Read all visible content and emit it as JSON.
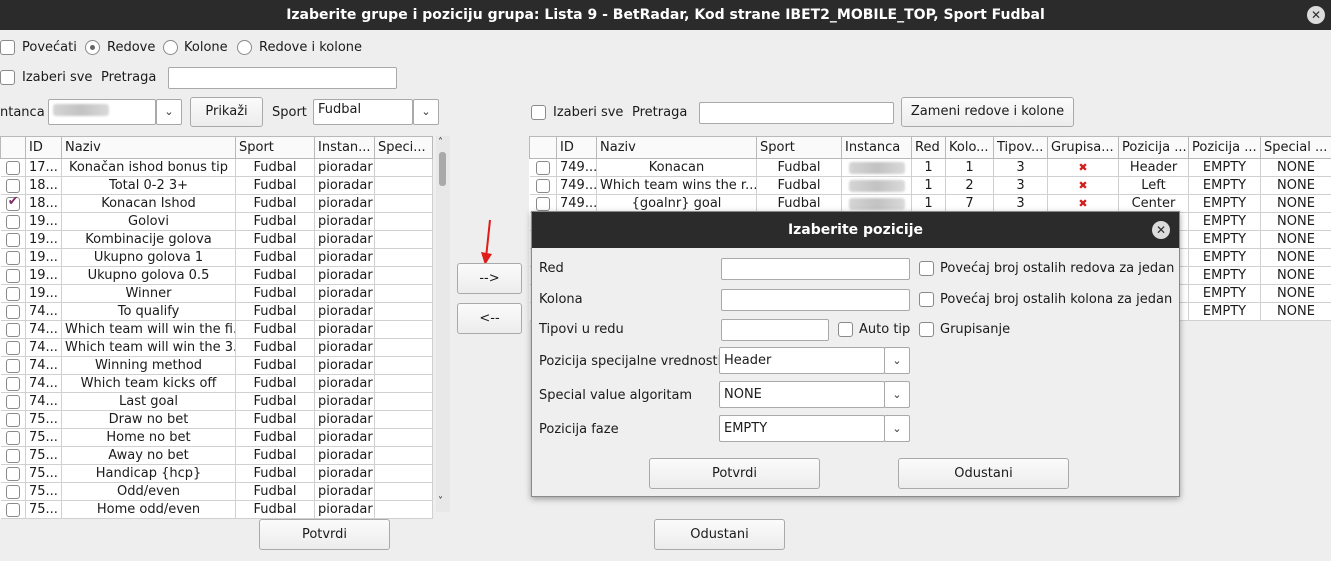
{
  "window": {
    "title": "Izaberite grupe i poziciju grupa: Lista 9 - BetRadar, Kod strane IBET2_MOBILE_TOP, Sport Fudbal",
    "close": "✕"
  },
  "top_options": {
    "povecati": "Povećati",
    "redove": "Redove",
    "kolone": "Kolone",
    "redove_i_kolone": "Redove i kolone"
  },
  "left": {
    "select_all": "Izaberi sve",
    "search_label": "Pretraga",
    "search_value": "",
    "instance_label": "ntanca",
    "show_button": "Prikaži",
    "sport_label": "Sport",
    "sport_value": "Fudbal",
    "columns": [
      "",
      "ID",
      "Naziv",
      "Sport",
      "Instan...",
      "Speci..."
    ],
    "rows": [
      {
        "checked": false,
        "id": "17...",
        "naziv": "Konačan ishod bonus tip",
        "sport": "Fudbal",
        "instanca": "pioradar"
      },
      {
        "checked": false,
        "id": "18...",
        "naziv": "Total 0-2 3+",
        "sport": "Fudbal",
        "instanca": "pioradar"
      },
      {
        "checked": true,
        "id": "18...",
        "naziv": "Konacan Ishod",
        "sport": "Fudbal",
        "instanca": "pioradar"
      },
      {
        "checked": false,
        "id": "19...",
        "naziv": "Golovi",
        "sport": "Fudbal",
        "instanca": "pioradar"
      },
      {
        "checked": false,
        "id": "19...",
        "naziv": "Kombinacije golova",
        "sport": "Fudbal",
        "instanca": "pioradar"
      },
      {
        "checked": false,
        "id": "19...",
        "naziv": "Ukupno golova 1",
        "sport": "Fudbal",
        "instanca": "pioradar"
      },
      {
        "checked": false,
        "id": "19...",
        "naziv": "Ukupno golova 0.5",
        "sport": "Fudbal",
        "instanca": "pioradar"
      },
      {
        "checked": false,
        "id": "19...",
        "naziv": "Winner",
        "sport": "Fudbal",
        "instanca": "pioradar"
      },
      {
        "checked": false,
        "id": "74...",
        "naziv": "To qualify",
        "sport": "Fudbal",
        "instanca": "pioradar"
      },
      {
        "checked": false,
        "id": "74...",
        "naziv": "Which team will win the fi...",
        "sport": "Fudbal",
        "instanca": "pioradar"
      },
      {
        "checked": false,
        "id": "74...",
        "naziv": "Which team will win the 3...",
        "sport": "Fudbal",
        "instanca": "pioradar"
      },
      {
        "checked": false,
        "id": "74...",
        "naziv": "Winning method",
        "sport": "Fudbal",
        "instanca": "pioradar"
      },
      {
        "checked": false,
        "id": "74...",
        "naziv": "Which team kicks off",
        "sport": "Fudbal",
        "instanca": "pioradar"
      },
      {
        "checked": false,
        "id": "74...",
        "naziv": "Last goal",
        "sport": "Fudbal",
        "instanca": "pioradar"
      },
      {
        "checked": false,
        "id": "75...",
        "naziv": "Draw no bet",
        "sport": "Fudbal",
        "instanca": "pioradar"
      },
      {
        "checked": false,
        "id": "75...",
        "naziv": "Home no bet",
        "sport": "Fudbal",
        "instanca": "pioradar"
      },
      {
        "checked": false,
        "id": "75...",
        "naziv": "Away no bet",
        "sport": "Fudbal",
        "instanca": "pioradar"
      },
      {
        "checked": false,
        "id": "75...",
        "naziv": "Handicap {hcp}",
        "sport": "Fudbal",
        "instanca": "pioradar"
      },
      {
        "checked": false,
        "id": "75...",
        "naziv": "Odd/even",
        "sport": "Fudbal",
        "instanca": "pioradar"
      },
      {
        "checked": false,
        "id": "75...",
        "naziv": "Home odd/even",
        "sport": "Fudbal",
        "instanca": "pioradar"
      }
    ]
  },
  "move": {
    "right": "-->",
    "left": "<--"
  },
  "right": {
    "select_all": "Izaberi sve",
    "search_label": "Pretraga",
    "search_value": "",
    "swap_button": "Zameni redove i kolone",
    "columns": [
      "",
      "ID",
      "Naziv",
      "Sport",
      "Instanca",
      "Red",
      "Kolo...",
      "Tipov...",
      "Grupisa...",
      "Pozicija ...",
      "Pozicija ...",
      "Special ..."
    ],
    "rows": [
      {
        "id": "749...",
        "naziv": "Konacan",
        "sport": "Fudbal",
        "red": "1",
        "kolona": "1",
        "tipovi": "3",
        "pozicija1": "Header",
        "pozicija2": "EMPTY",
        "special": "NONE"
      },
      {
        "id": "749...",
        "naziv": "Which team wins the r...",
        "sport": "Fudbal",
        "red": "1",
        "kolona": "2",
        "tipovi": "3",
        "pozicija1": "Left",
        "pozicija2": "EMPTY",
        "special": "NONE"
      },
      {
        "id": "749...",
        "naziv": "{goalnr} goal",
        "sport": "Fudbal",
        "red": "1",
        "kolona": "7",
        "tipovi": "3",
        "pozicija1": "Center",
        "pozicija2": "EMPTY",
        "special": "NONE"
      },
      {
        "id": "",
        "naziv": "",
        "sport": "",
        "red": "",
        "kolona": "",
        "tipovi": "",
        "pozicija1": "",
        "pozicija2": "EMPTY",
        "special": "NONE"
      },
      {
        "id": "",
        "naziv": "",
        "sport": "",
        "red": "",
        "kolona": "",
        "tipovi": "",
        "pozicija1": "",
        "pozicija2": "EMPTY",
        "special": "NONE"
      },
      {
        "id": "",
        "naziv": "",
        "sport": "",
        "red": "",
        "kolona": "",
        "tipovi": "",
        "pozicija1": "",
        "pozicija2": "EMPTY",
        "special": "NONE"
      },
      {
        "id": "",
        "naziv": "",
        "sport": "",
        "red": "",
        "kolona": "",
        "tipovi": "",
        "pozicija1": "",
        "pozicija2": "EMPTY",
        "special": "NONE"
      },
      {
        "id": "",
        "naziv": "",
        "sport": "",
        "red": "",
        "kolona": "",
        "tipovi": "",
        "pozicija1": "",
        "pozicija2": "EMPTY",
        "special": "NONE"
      },
      {
        "id": "",
        "naziv": "",
        "sport": "",
        "red": "",
        "kolona": "",
        "tipovi": "",
        "pozicija1": "",
        "pozicija2": "EMPTY",
        "special": "NONE"
      }
    ]
  },
  "bottom": {
    "confirm": "Potvrdi",
    "cancel": "Odustani"
  },
  "dialog": {
    "title": "Izaberite pozicije",
    "close": "✕",
    "red_label": "Red",
    "kolona_label": "Kolona",
    "tipovi_label": "Tipovi u redu",
    "povecaj_redova": "Povećaj broj ostalih redova za jedan",
    "povecaj_kolona": "Povećaj broj ostalih kolona za jedan",
    "auto_tip": "Auto tip",
    "grupisanje": "Grupisanje",
    "pozicija_spec_label": "Pozicija specijalne vrednosti",
    "pozicija_spec_value": "Header",
    "special_alg_label": "Special value algoritam",
    "special_alg_value": "NONE",
    "pozicija_faze_label": "Pozicija faze",
    "pozicija_faze_value": "EMPTY",
    "confirm": "Potvrdi",
    "cancel": "Odustani"
  },
  "colors": {
    "titlebar": "#2b2b2b",
    "check": "#7a2e64",
    "delete_icon": "#d41b1b",
    "arrow": "#e01b1b"
  }
}
